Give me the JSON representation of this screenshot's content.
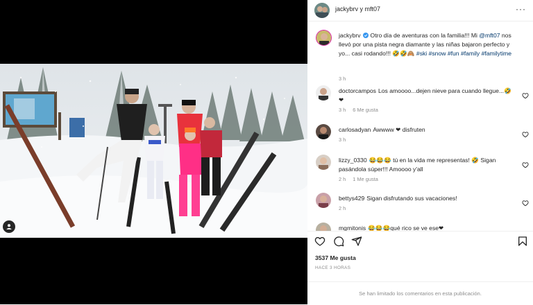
{
  "header": {
    "account_names": "jackybrv y mft07",
    "more_icon": "more-dots-icon"
  },
  "caption": {
    "username": "jackybrv",
    "text": "Otro día de aventuras con la familia!!! Mi @mft07 nos llevó por una pista negra diamante y las niñas bajaron perfecto y yo... casi rodando!!! 🤣🤣🙈 #ski #snow #fun #family #familytime",
    "time": "3 h"
  },
  "comments": [
    {
      "username": "doctorcampos",
      "text": "Los amoooo...dejen nieve para cuando llegue...🤣❤",
      "time": "3 h",
      "likes": "6 Me gusta"
    },
    {
      "username": "carlosadyan",
      "text": "Awwww ❤ disfruten",
      "time": "3 h",
      "likes": ""
    },
    {
      "username": "lizzy_0330",
      "text": "😂😂😂 tú en la vida me representas! 🤣 Sigan pasándola súper!!! Amoooo y'all",
      "time": "2 h",
      "likes": "1 Me gusta"
    },
    {
      "username": "bettys429",
      "text": "Sigan disfrutando sus vacaciones!",
      "time": "2 h",
      "likes": ""
    },
    {
      "username": "mgmitonis",
      "text": "😂😂😂qué rico se ve ese❤",
      "time": "",
      "likes": ""
    }
  ],
  "actions": {
    "like_icon": "heart-icon",
    "comment_icon": "comment-icon",
    "share_icon": "share-icon",
    "save_icon": "bookmark-icon"
  },
  "likes_count": "3537 Me gusta",
  "posted_time": "HACE 3 HORAS",
  "comments_limited": "Se han limitado los comentarios en esta publicación.",
  "colors": {
    "link": "#00376b",
    "muted": "#8e8e8e",
    "heart_red": "#ed4956",
    "verified": "#3897f0"
  }
}
